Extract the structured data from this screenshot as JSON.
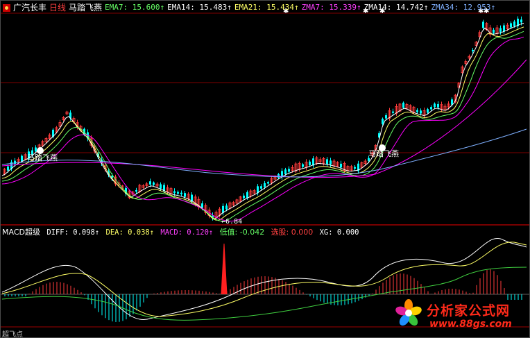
{
  "header": {
    "stock_name": "广汽长丰",
    "period": "日线",
    "indicator_name": "马踏飞燕",
    "ema7": "EMA7: 15.600↑",
    "ema14": "EMA14: 15.483↑",
    "ema21": "EMA21: 15.434↑",
    "zma7": "ZMA7: 15.339↑",
    "zma14": "ZMA14: 14.742↑",
    "zma34": "ZMA34: 12.953↑"
  },
  "sub": {
    "name": "MACD超级",
    "diff": "DIFF: 0.098↑",
    "dea": "DEA: 0.038↑",
    "macd": "MACD: 0.120↑",
    "low": "低值: -0.042",
    "pick": "选股: 0.000",
    "xg": "XG: 0.000"
  },
  "chart": {
    "low_price": "6.84",
    "signal_label_1": "马踏飞燕",
    "signal_label_2": "马踏飞燕"
  },
  "bottom_label": "超飞点",
  "watermark": {
    "text": "分析家公式网",
    "url": "www.88gs.com"
  },
  "colors": {
    "up": "#ff3c3c",
    "down": "#00ffff",
    "ema7": "#ffffff",
    "ema14": "#ffff66",
    "ema21": "#66ff66",
    "zma7": "#ff00ff",
    "zma14": "#7fb0ff",
    "zma34": "#c0c0ff",
    "grid": "#800000"
  }
}
